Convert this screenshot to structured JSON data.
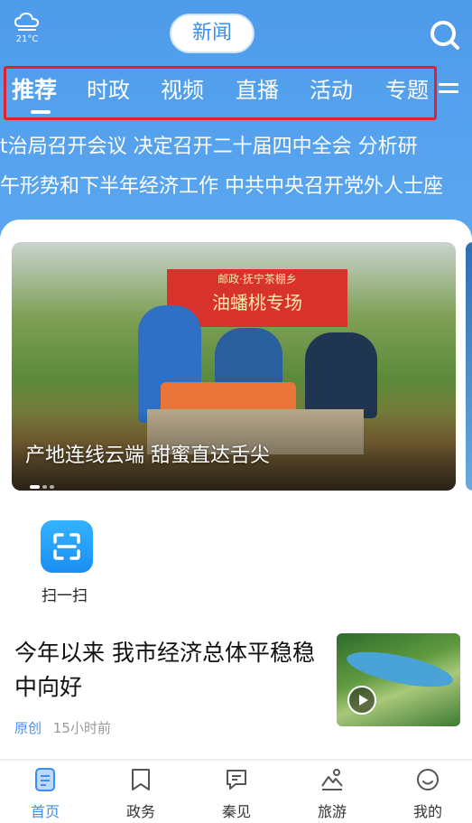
{
  "header": {
    "weather_temp": "21°C",
    "weather_icon": "cloud-icon",
    "channel_pill": "新闻",
    "search_icon": "search-icon"
  },
  "tabs": [
    "推荐",
    "时政",
    "视频",
    "直播",
    "活动",
    "专题"
  ],
  "active_tab": "推荐",
  "ticker": {
    "line1": "t治局召开会议 决定召开二十届四中全会 分析研",
    "line2": "午形势和下半年经济工作 中共中央召开党外人士座"
  },
  "banner": {
    "caption": "产地连线云端 甜蜜直达舌尖",
    "sign_top": "邮政·抚宁茶棚乡",
    "sign_main": "油蟠桃专场",
    "slide_count": 3,
    "active_slide": 1
  },
  "quick": {
    "scan_label": "扫一扫"
  },
  "article": {
    "title": "今年以来 我市经济总体平稳稳中向好",
    "tag": "原创",
    "time": "15小时前"
  },
  "nav": [
    {
      "label": "首页",
      "icon": "home-doc-icon"
    },
    {
      "label": "政务",
      "icon": "bookmark-icon"
    },
    {
      "label": "秦见",
      "icon": "chat-icon"
    },
    {
      "label": "旅游",
      "icon": "landscape-icon"
    },
    {
      "label": "我的",
      "icon": "profile-smile-icon"
    }
  ],
  "colors": {
    "header_bg": "#5aa6f0",
    "accent": "#3b8ef0",
    "highlight_box": "#e0222f"
  }
}
